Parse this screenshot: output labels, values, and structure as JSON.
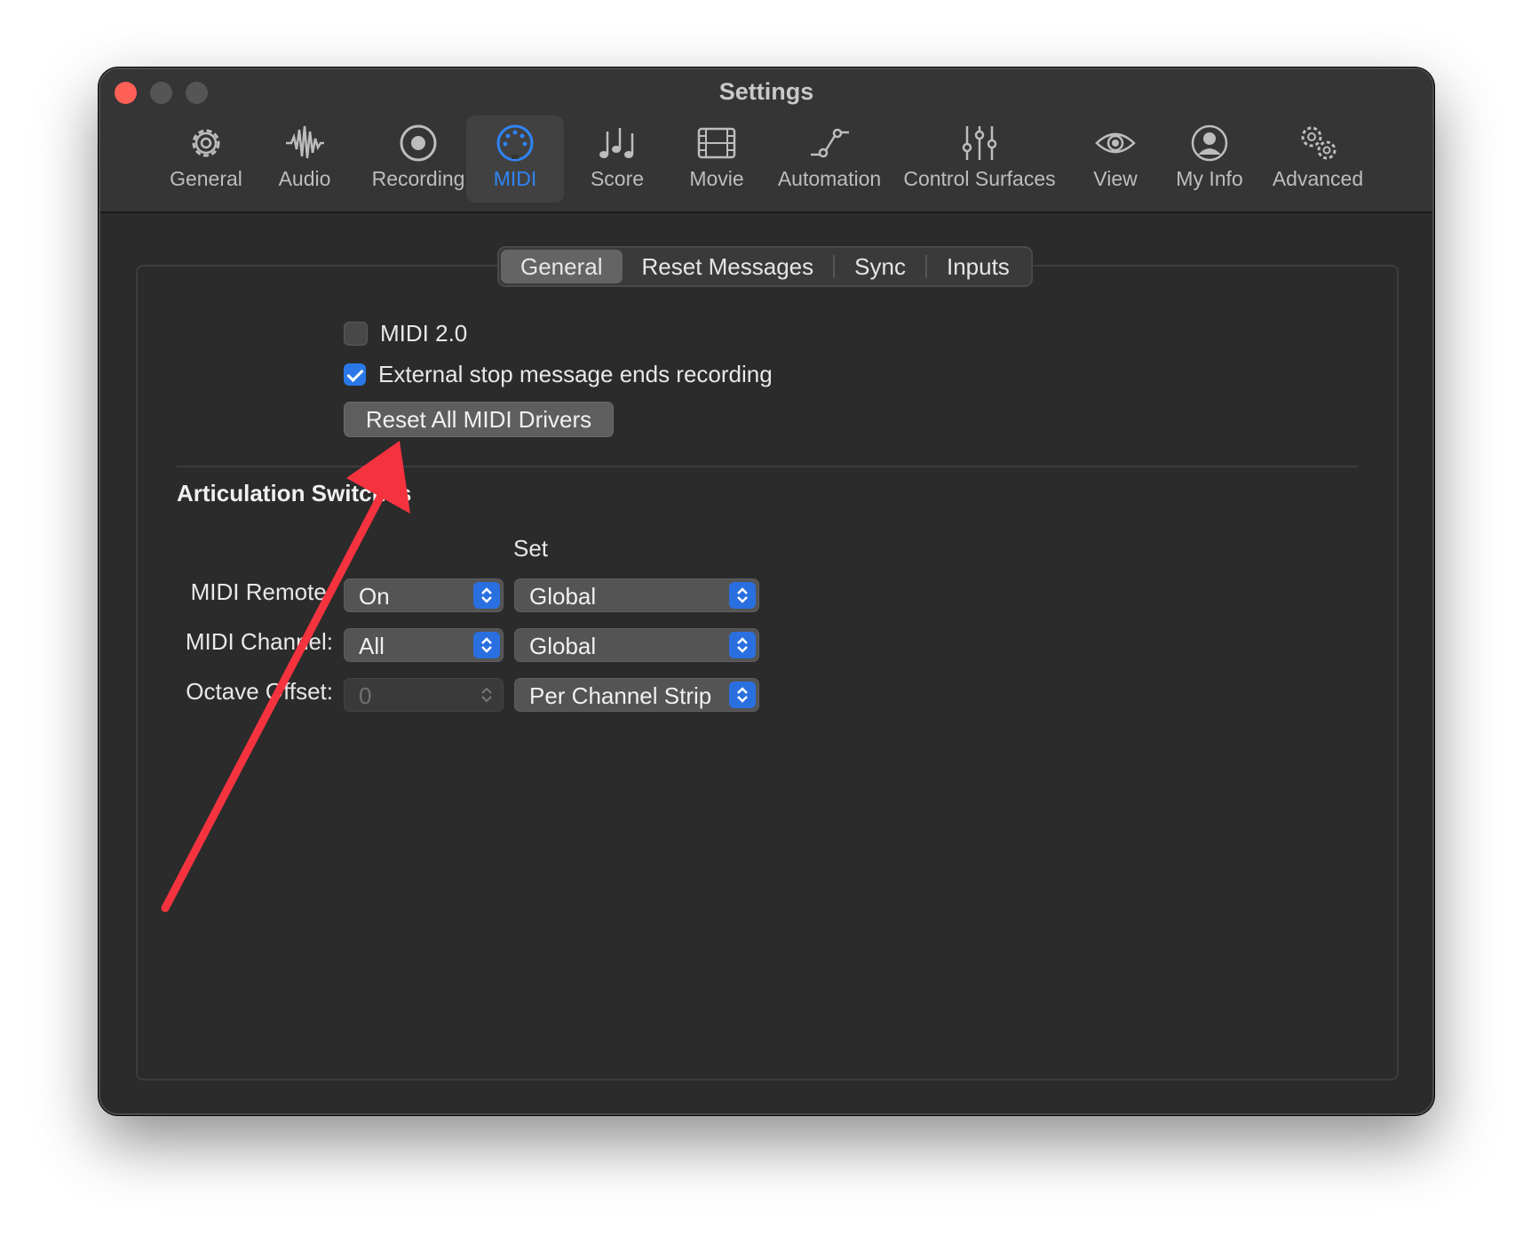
{
  "window": {
    "title": "Settings"
  },
  "toolbar": {
    "items": [
      {
        "label": "General",
        "icon": "gear-icon"
      },
      {
        "label": "Audio",
        "icon": "waveform-icon"
      },
      {
        "label": "Recording",
        "icon": "record-icon"
      },
      {
        "label": "MIDI",
        "icon": "midi-port-icon",
        "active": true
      },
      {
        "label": "Score",
        "icon": "music-notes-icon"
      },
      {
        "label": "Movie",
        "icon": "film-icon"
      },
      {
        "label": "Automation",
        "icon": "automation-curve-icon"
      },
      {
        "label": "Control Surfaces",
        "icon": "sliders-icon"
      },
      {
        "label": "View",
        "icon": "eye-icon"
      },
      {
        "label": "My Info",
        "icon": "person-circle-icon"
      },
      {
        "label": "Advanced",
        "icon": "gears-icon"
      }
    ],
    "accent": "#2f84f6"
  },
  "tabs": [
    "General",
    "Reset Messages",
    "Sync",
    "Inputs"
  ],
  "general": {
    "midi2_label": "MIDI 2.0",
    "midi2_checked": false,
    "external_stop_label": "External stop message ends recording",
    "external_stop_checked": true,
    "reset_button": "Reset All MIDI Drivers"
  },
  "articulation": {
    "title": "Articulation Switches",
    "set_header": "Set",
    "rows": [
      {
        "label": "MIDI Remote:",
        "value": "On",
        "set": "Global",
        "enabled": true
      },
      {
        "label": "MIDI Channel:",
        "value": "All",
        "set": "Global",
        "enabled": true
      },
      {
        "label": "Octave Offset:",
        "value": "0",
        "set": "Per Channel Strip",
        "enabled": false
      }
    ]
  },
  "annotation": {
    "color": "#f5333f"
  }
}
